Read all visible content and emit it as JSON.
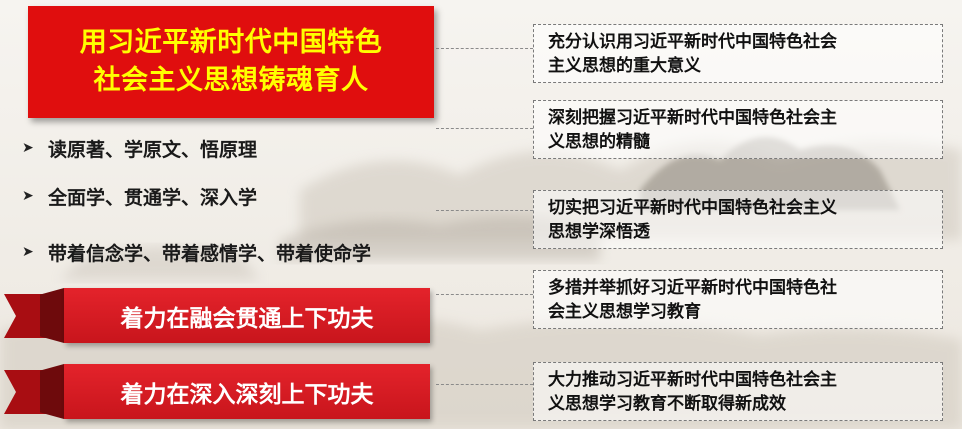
{
  "title": {
    "line1": "用习近平新时代中国特色",
    "line2": "社会主义思想铸魂育人"
  },
  "bullets": [
    "读原著、学原文、悟原理",
    "全面学、贯通学、深入学",
    "带着信念学、带着感情学、带着使命学"
  ],
  "bullet_icon": "arrow-right-icon",
  "ribbons": [
    "着力在融会贯通上下功夫",
    "着力在深入深刻上下功夫"
  ],
  "right_items": [
    {
      "line1": "充分认识用习近平新时代中国特色社会",
      "line2": "主义思想的重大意义"
    },
    {
      "line1": "深刻把握习近平新时代中国特色社会主",
      "line2": "义思想的精髓"
    },
    {
      "line1": "切实把习近平新时代中国特色社会主义",
      "line2": "思想学深悟透"
    },
    {
      "line1": "多措并举抓好习近平新时代中国特色社",
      "line2": "会主义思想学习教育"
    },
    {
      "line1": "大力推动习近平新时代中国特色社会主",
      "line2": "义思想学习教育不断取得新成效"
    }
  ],
  "colors": {
    "title_bg": "#e00e0e",
    "title_text": "#ffff00",
    "ribbon": "#d11a21",
    "background": "#f4f1ec"
  }
}
